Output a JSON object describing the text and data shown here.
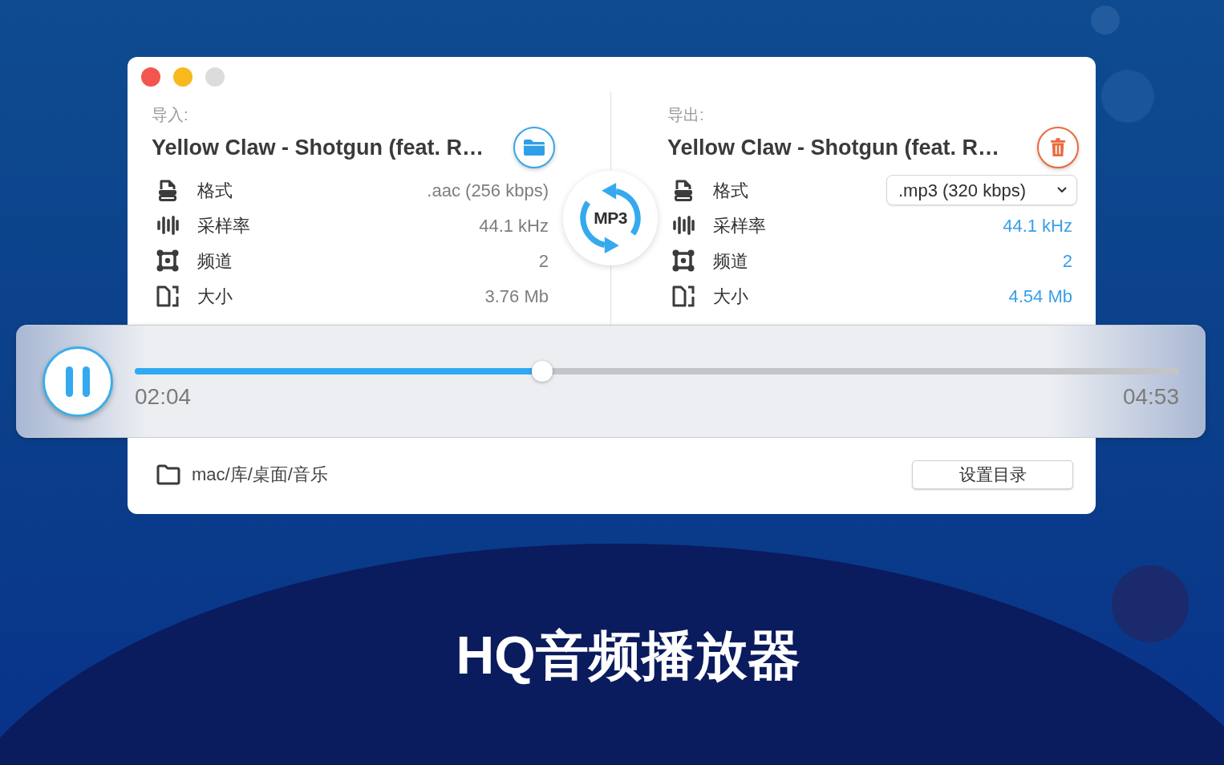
{
  "window": {
    "zoom_enabled": false
  },
  "input": {
    "label": "导入:",
    "title": "Yellow Claw - Shotgun (feat. R…",
    "fields": [
      {
        "label": "格式",
        "value": ".aac (256 kbps)",
        "kind": "text"
      },
      {
        "label": "采样率",
        "value": "44.1 kHz",
        "kind": "text"
      },
      {
        "label": "频道",
        "value": "2",
        "kind": "text"
      },
      {
        "label": "大小",
        "value": "3.76 Mb",
        "kind": "text"
      }
    ]
  },
  "converter": {
    "badge": "MP3"
  },
  "output": {
    "label": "导出:",
    "title": "Yellow Claw - Shotgun (feat. R…",
    "fields": [
      {
        "label": "格式",
        "value": ".mp3 (320 kbps)",
        "kind": "select"
      },
      {
        "label": "采样率",
        "value": "44.1 kHz",
        "kind": "text"
      },
      {
        "label": "频道",
        "value": "2",
        "kind": "text"
      },
      {
        "label": "大小",
        "value": "4.54 Mb",
        "kind": "text"
      }
    ]
  },
  "player": {
    "playing": true,
    "level": 0.39,
    "elapsed": "02:04",
    "duration": "04:53"
  },
  "footer": {
    "path": "mac/库/桌面/音乐",
    "button": "设置目录"
  },
  "headline": "HQ音频播放器"
}
